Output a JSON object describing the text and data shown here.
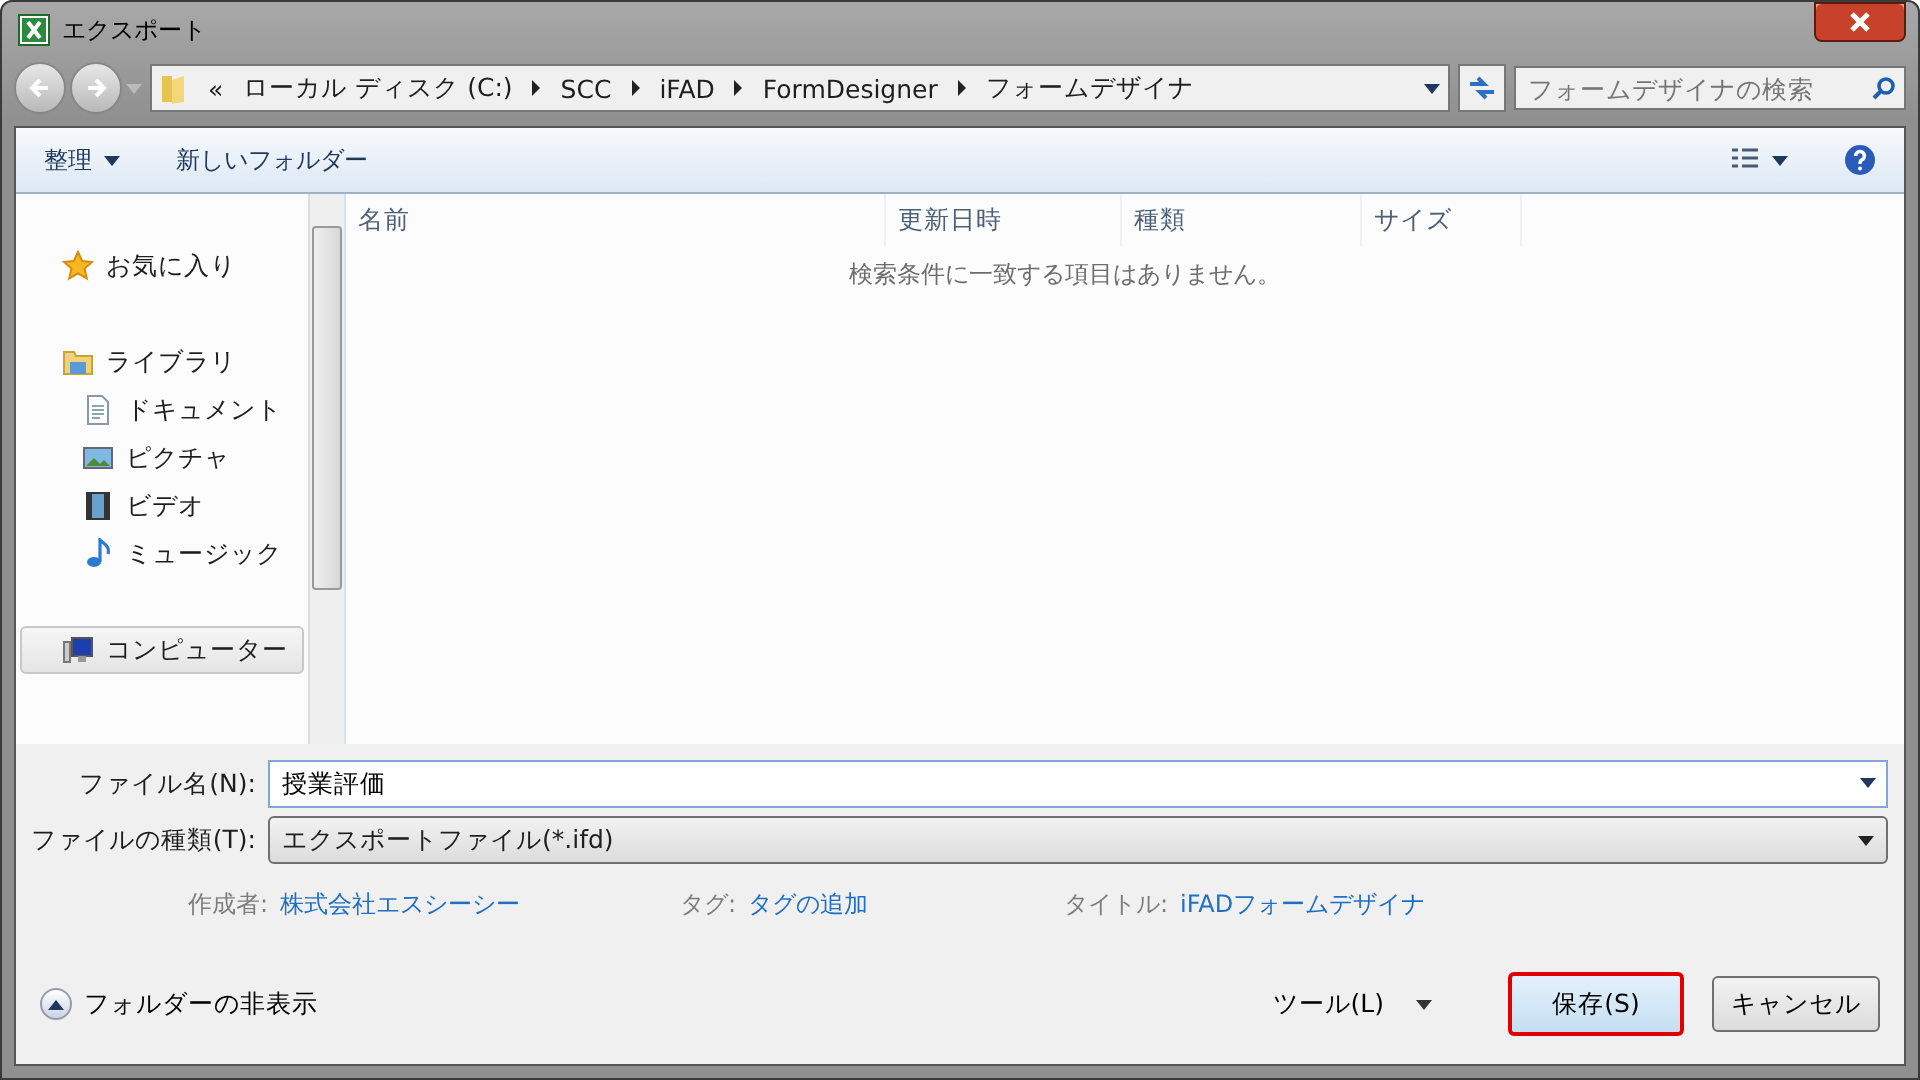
{
  "window": {
    "title": "エクスポート"
  },
  "address_bar": {
    "overflow": "«",
    "path": [
      "ローカル ディスク (C:)",
      "SCC",
      "iFAD",
      "FormDesigner",
      "フォームデザイナ"
    ]
  },
  "search": {
    "placeholder": "フォームデザイナの検索"
  },
  "toolbar": {
    "organize": "整理",
    "new_folder": "新しいフォルダー"
  },
  "sidebar": {
    "items": [
      {
        "label": "お気に入り",
        "kind": "favorites",
        "selected": false
      },
      {
        "label": "ライブラリ",
        "kind": "libraries",
        "selected": false,
        "children": [
          {
            "label": "ドキュメント",
            "kind": "documents",
            "selected": false
          },
          {
            "label": "ピクチャ",
            "kind": "pictures",
            "selected": false
          },
          {
            "label": "ビデオ",
            "kind": "videos",
            "selected": false
          },
          {
            "label": "ミュージック",
            "kind": "music",
            "selected": false
          }
        ]
      },
      {
        "label": "コンピューター",
        "kind": "computer",
        "selected": true
      }
    ]
  },
  "file_list": {
    "columns": [
      "名前",
      "更新日時",
      "種類",
      "サイズ"
    ],
    "empty_message": "検索条件に一致する項目はありません。"
  },
  "form": {
    "file_name_label": "ファイル名(N):",
    "file_name_value": "授業評価",
    "file_type_label": "ファイルの種類(T):",
    "file_type_value": "エクスポートファイル(*.ifd)"
  },
  "metadata": [
    {
      "label": "作成者:",
      "value": "株式会社エスシーシー"
    },
    {
      "label": "タグ:",
      "value": "タグの追加"
    },
    {
      "label": "タイトル:",
      "value": "iFADフォームデザイナ"
    }
  ],
  "hide_folders": "フォルダーの非表示",
  "tools": "ツール(L)",
  "buttons": [
    {
      "label": "保存(S)",
      "default": true
    },
    {
      "label": "キャンセル",
      "default": false
    }
  ]
}
